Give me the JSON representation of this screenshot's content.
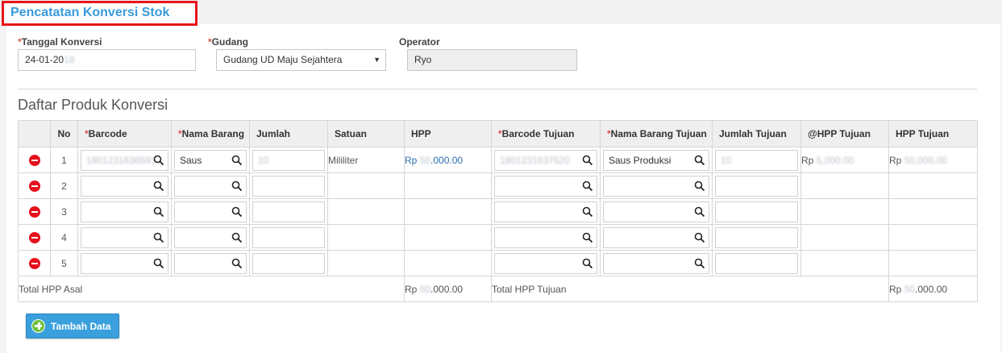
{
  "page": {
    "title": "Pencatatan Konversi Stok"
  },
  "form": {
    "tanggal": {
      "label": "Tanggal Konversi",
      "value": "24-01-2018"
    },
    "gudang": {
      "label": "Gudang",
      "value": "Gudang UD Maju Sejahtera"
    },
    "operator": {
      "label": "Operator",
      "value": "Ryo"
    }
  },
  "section_title": "Daftar Produk Konversi",
  "table": {
    "headers": {
      "no": "No",
      "barcode": "Barcode",
      "nama_barang": "Nama Barang",
      "jumlah": "Jumlah",
      "satuan": "Satuan",
      "hpp": "HPP",
      "barcode_tujuan": "Barcode Tujuan",
      "nama_barang_tujuan": "Nama Barang Tujuan",
      "jumlah_tujuan": "Jumlah Tujuan",
      "hpp_tujuan_unit": "@HPP Tujuan",
      "hpp_tujuan": "HPP Tujuan"
    },
    "row1": {
      "no": "1",
      "barcode": "1801231636591",
      "nama_barang": "Saus",
      "jumlah": "10",
      "satuan": "Mililiter",
      "hpp_prefix": "Rp",
      "hpp_hidden": "50",
      "hpp_suffix": ".000.00",
      "barcode_tujuan": "1801231637520",
      "nama_barang_tujuan": "Saus Produksi",
      "jumlah_tujuan": "10",
      "hpp_unit_prefix": "Rp",
      "hpp_unit_hidden": "5,000.00",
      "hpp_tujuan_prefix": "Rp",
      "hpp_tujuan_hidden": "50,000.00"
    },
    "empty_rows": [
      "2",
      "3",
      "4",
      "5"
    ],
    "footer": {
      "total_asal_label": "Total HPP Asal",
      "total_asal_prefix": "Rp",
      "total_asal_hidden": "50",
      "total_asal_suffix": ".000.00",
      "total_tujuan_label": "Total HPP Tujuan",
      "total_tujuan_prefix": "Rp",
      "total_tujuan_hidden": "50",
      "total_tujuan_suffix": ".000.00"
    }
  },
  "buttons": {
    "tambah": "Tambah Data"
  },
  "colors": {
    "accent": "#3a9ad9",
    "required": "#d9534f",
    "delete": "#e5101b",
    "add": "#6fc23b",
    "highlight_box": "#e8141b"
  }
}
